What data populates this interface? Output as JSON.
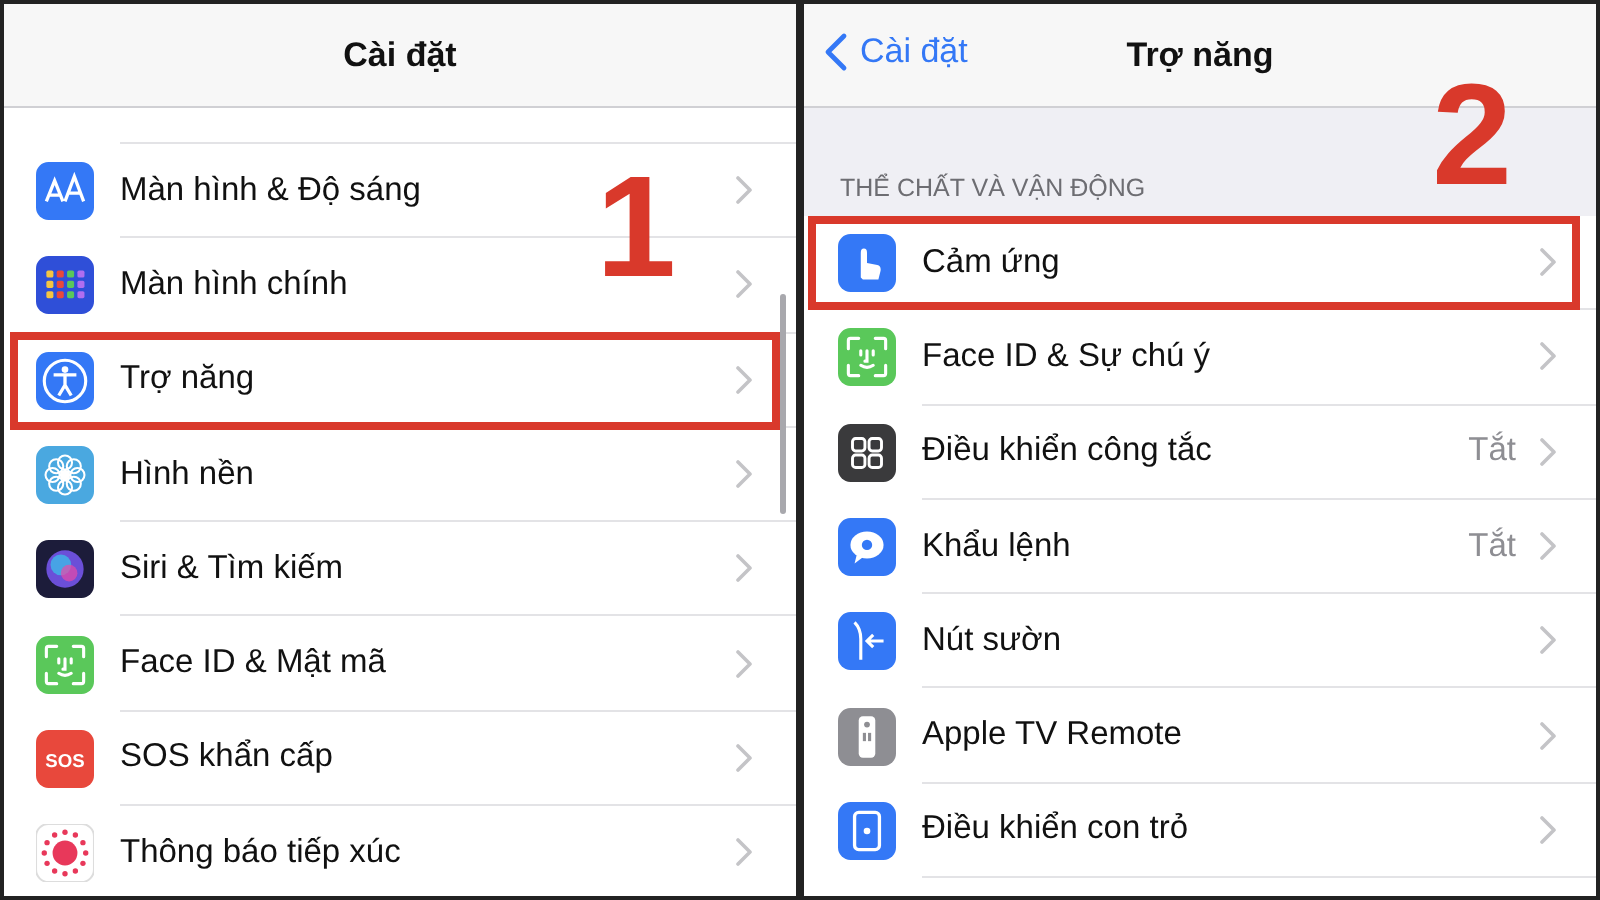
{
  "panels": [
    {
      "title": "Cài đặt",
      "step": "1",
      "rows": [
        {
          "kind": "display",
          "color": "#3478f6",
          "label": "Màn hình & Độ sáng",
          "highlighted": false
        },
        {
          "kind": "homescreen",
          "color": "#2f4fd8",
          "label": "Màn hình chính",
          "highlighted": false
        },
        {
          "kind": "accessibility",
          "color": "#3478f6",
          "label": "Trợ năng",
          "highlighted": true
        },
        {
          "kind": "wallpaper",
          "color": "#4aa8e0",
          "label": "Hình nền",
          "highlighted": false
        },
        {
          "kind": "siri",
          "color": "#1c1c3a",
          "label": "Siri & Tìm kiếm",
          "highlighted": false
        },
        {
          "kind": "faceid",
          "color": "#5ac85a",
          "label": "Face ID & Mật mã",
          "highlighted": false
        },
        {
          "kind": "sos",
          "color": "#e8483c",
          "icon_text": "SOS",
          "label": "SOS khẩn cấp",
          "highlighted": false
        },
        {
          "kind": "exposure",
          "color": "#e8385a",
          "label": "Thông báo tiếp xúc",
          "highlighted": false
        }
      ]
    },
    {
      "back": "Cài đặt",
      "title": "Trợ năng",
      "step": "2",
      "section": "THỂ CHẤT VÀ VẬN ĐỘNG",
      "rows": [
        {
          "kind": "touch",
          "color": "#3478f6",
          "label": "Cảm ứng",
          "highlighted": true
        },
        {
          "kind": "faceid",
          "color": "#5ac85a",
          "label": "Face ID & Sự chú ý",
          "highlighted": false
        },
        {
          "kind": "switch",
          "color": "#3a3a3c",
          "label": "Điều khiển công tắc",
          "value": "Tắt",
          "highlighted": false
        },
        {
          "kind": "voice",
          "color": "#3478f6",
          "label": "Khẩu lệnh",
          "value": "Tắt",
          "highlighted": false
        },
        {
          "kind": "sidebutton",
          "color": "#3478f6",
          "label": "Nút sườn",
          "highlighted": false
        },
        {
          "kind": "remote",
          "color": "#8e8e93",
          "label": "Apple TV Remote",
          "highlighted": false
        },
        {
          "kind": "pointer",
          "color": "#3478f6",
          "label": "Điều khiển con trỏ",
          "highlighted": false
        }
      ]
    }
  ]
}
